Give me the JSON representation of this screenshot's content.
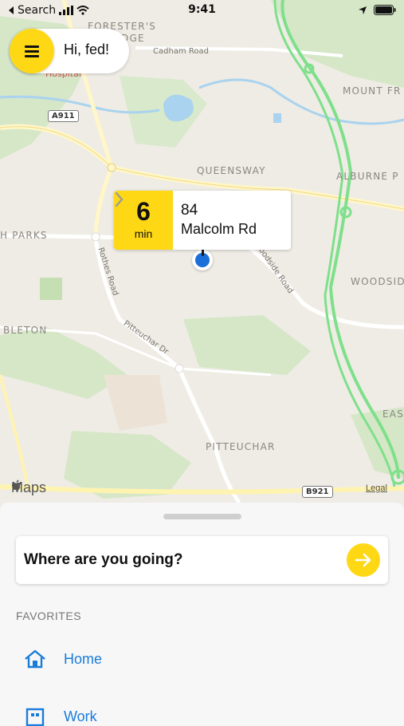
{
  "status_bar": {
    "back_label": "Search",
    "time": "9:41"
  },
  "map": {
    "labels": {
      "foresters": "FORESTER'S",
      "lodge_fragment": "DGE",
      "hospital": "Hospital",
      "queensway": "QUEENSWAY",
      "mount_frost": "MOUNT FR",
      "alburne_park": "ALBURNE P",
      "h_parks": "H PARKS",
      "woodside": "WOODSID",
      "bleton": "BLETON",
      "eas": "EAS",
      "pitteuchar": "PITTEUCHAR"
    },
    "roads": {
      "cadham": "Cadham Road",
      "rothes": "Rothes Road",
      "pitteuchar_dr": "Pitteuchar Dr",
      "woodside_road": "Woodside Road",
      "a911": "A911",
      "b921": "B921"
    },
    "attribution": "Maps",
    "legal": "Legal"
  },
  "greeting": "Hi, fed!",
  "eta": {
    "value": "6",
    "unit": "min",
    "address_number": "84",
    "address_street": "Malcolm Rd"
  },
  "search": {
    "prompt": "Where are you going?"
  },
  "favorites": {
    "header": "FAVORITES",
    "items": [
      {
        "label": "Home",
        "icon": "home-icon"
      },
      {
        "label": "Work",
        "icon": "work-icon"
      }
    ]
  },
  "colors": {
    "accent": "#ffd815",
    "link": "#1a7cd9",
    "pin": "#1a6fd9",
    "route": "#7ee08a"
  }
}
